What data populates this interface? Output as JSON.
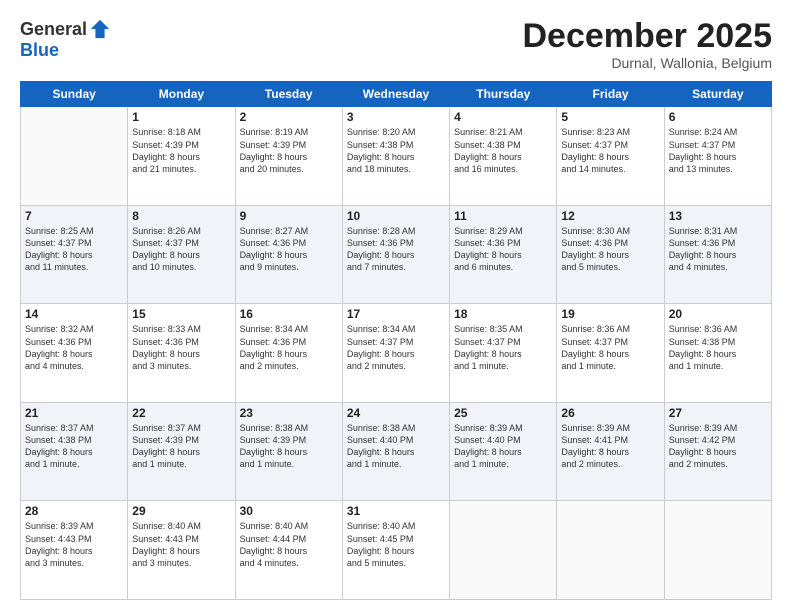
{
  "logo": {
    "general": "General",
    "blue": "Blue"
  },
  "title": "December 2025",
  "location": "Durnal, Wallonia, Belgium",
  "days": [
    "Sunday",
    "Monday",
    "Tuesday",
    "Wednesday",
    "Thursday",
    "Friday",
    "Saturday"
  ],
  "weeks": [
    [
      {
        "day": "",
        "info": ""
      },
      {
        "day": "1",
        "info": "Sunrise: 8:18 AM\nSunset: 4:39 PM\nDaylight: 8 hours\nand 21 minutes."
      },
      {
        "day": "2",
        "info": "Sunrise: 8:19 AM\nSunset: 4:39 PM\nDaylight: 8 hours\nand 20 minutes."
      },
      {
        "day": "3",
        "info": "Sunrise: 8:20 AM\nSunset: 4:38 PM\nDaylight: 8 hours\nand 18 minutes."
      },
      {
        "day": "4",
        "info": "Sunrise: 8:21 AM\nSunset: 4:38 PM\nDaylight: 8 hours\nand 16 minutes."
      },
      {
        "day": "5",
        "info": "Sunrise: 8:23 AM\nSunset: 4:37 PM\nDaylight: 8 hours\nand 14 minutes."
      },
      {
        "day": "6",
        "info": "Sunrise: 8:24 AM\nSunset: 4:37 PM\nDaylight: 8 hours\nand 13 minutes."
      }
    ],
    [
      {
        "day": "7",
        "info": "Sunrise: 8:25 AM\nSunset: 4:37 PM\nDaylight: 8 hours\nand 11 minutes."
      },
      {
        "day": "8",
        "info": "Sunrise: 8:26 AM\nSunset: 4:37 PM\nDaylight: 8 hours\nand 10 minutes."
      },
      {
        "day": "9",
        "info": "Sunrise: 8:27 AM\nSunset: 4:36 PM\nDaylight: 8 hours\nand 9 minutes."
      },
      {
        "day": "10",
        "info": "Sunrise: 8:28 AM\nSunset: 4:36 PM\nDaylight: 8 hours\nand 7 minutes."
      },
      {
        "day": "11",
        "info": "Sunrise: 8:29 AM\nSunset: 4:36 PM\nDaylight: 8 hours\nand 6 minutes."
      },
      {
        "day": "12",
        "info": "Sunrise: 8:30 AM\nSunset: 4:36 PM\nDaylight: 8 hours\nand 5 minutes."
      },
      {
        "day": "13",
        "info": "Sunrise: 8:31 AM\nSunset: 4:36 PM\nDaylight: 8 hours\nand 4 minutes."
      }
    ],
    [
      {
        "day": "14",
        "info": "Sunrise: 8:32 AM\nSunset: 4:36 PM\nDaylight: 8 hours\nand 4 minutes."
      },
      {
        "day": "15",
        "info": "Sunrise: 8:33 AM\nSunset: 4:36 PM\nDaylight: 8 hours\nand 3 minutes."
      },
      {
        "day": "16",
        "info": "Sunrise: 8:34 AM\nSunset: 4:36 PM\nDaylight: 8 hours\nand 2 minutes."
      },
      {
        "day": "17",
        "info": "Sunrise: 8:34 AM\nSunset: 4:37 PM\nDaylight: 8 hours\nand 2 minutes."
      },
      {
        "day": "18",
        "info": "Sunrise: 8:35 AM\nSunset: 4:37 PM\nDaylight: 8 hours\nand 1 minute."
      },
      {
        "day": "19",
        "info": "Sunrise: 8:36 AM\nSunset: 4:37 PM\nDaylight: 8 hours\nand 1 minute."
      },
      {
        "day": "20",
        "info": "Sunrise: 8:36 AM\nSunset: 4:38 PM\nDaylight: 8 hours\nand 1 minute."
      }
    ],
    [
      {
        "day": "21",
        "info": "Sunrise: 8:37 AM\nSunset: 4:38 PM\nDaylight: 8 hours\nand 1 minute."
      },
      {
        "day": "22",
        "info": "Sunrise: 8:37 AM\nSunset: 4:39 PM\nDaylight: 8 hours\nand 1 minute."
      },
      {
        "day": "23",
        "info": "Sunrise: 8:38 AM\nSunset: 4:39 PM\nDaylight: 8 hours\nand 1 minute."
      },
      {
        "day": "24",
        "info": "Sunrise: 8:38 AM\nSunset: 4:40 PM\nDaylight: 8 hours\nand 1 minute."
      },
      {
        "day": "25",
        "info": "Sunrise: 8:39 AM\nSunset: 4:40 PM\nDaylight: 8 hours\nand 1 minute."
      },
      {
        "day": "26",
        "info": "Sunrise: 8:39 AM\nSunset: 4:41 PM\nDaylight: 8 hours\nand 2 minutes."
      },
      {
        "day": "27",
        "info": "Sunrise: 8:39 AM\nSunset: 4:42 PM\nDaylight: 8 hours\nand 2 minutes."
      }
    ],
    [
      {
        "day": "28",
        "info": "Sunrise: 8:39 AM\nSunset: 4:43 PM\nDaylight: 8 hours\nand 3 minutes."
      },
      {
        "day": "29",
        "info": "Sunrise: 8:40 AM\nSunset: 4:43 PM\nDaylight: 8 hours\nand 3 minutes."
      },
      {
        "day": "30",
        "info": "Sunrise: 8:40 AM\nSunset: 4:44 PM\nDaylight: 8 hours\nand 4 minutes."
      },
      {
        "day": "31",
        "info": "Sunrise: 8:40 AM\nSunset: 4:45 PM\nDaylight: 8 hours\nand 5 minutes."
      },
      {
        "day": "",
        "info": ""
      },
      {
        "day": "",
        "info": ""
      },
      {
        "day": "",
        "info": ""
      }
    ]
  ]
}
